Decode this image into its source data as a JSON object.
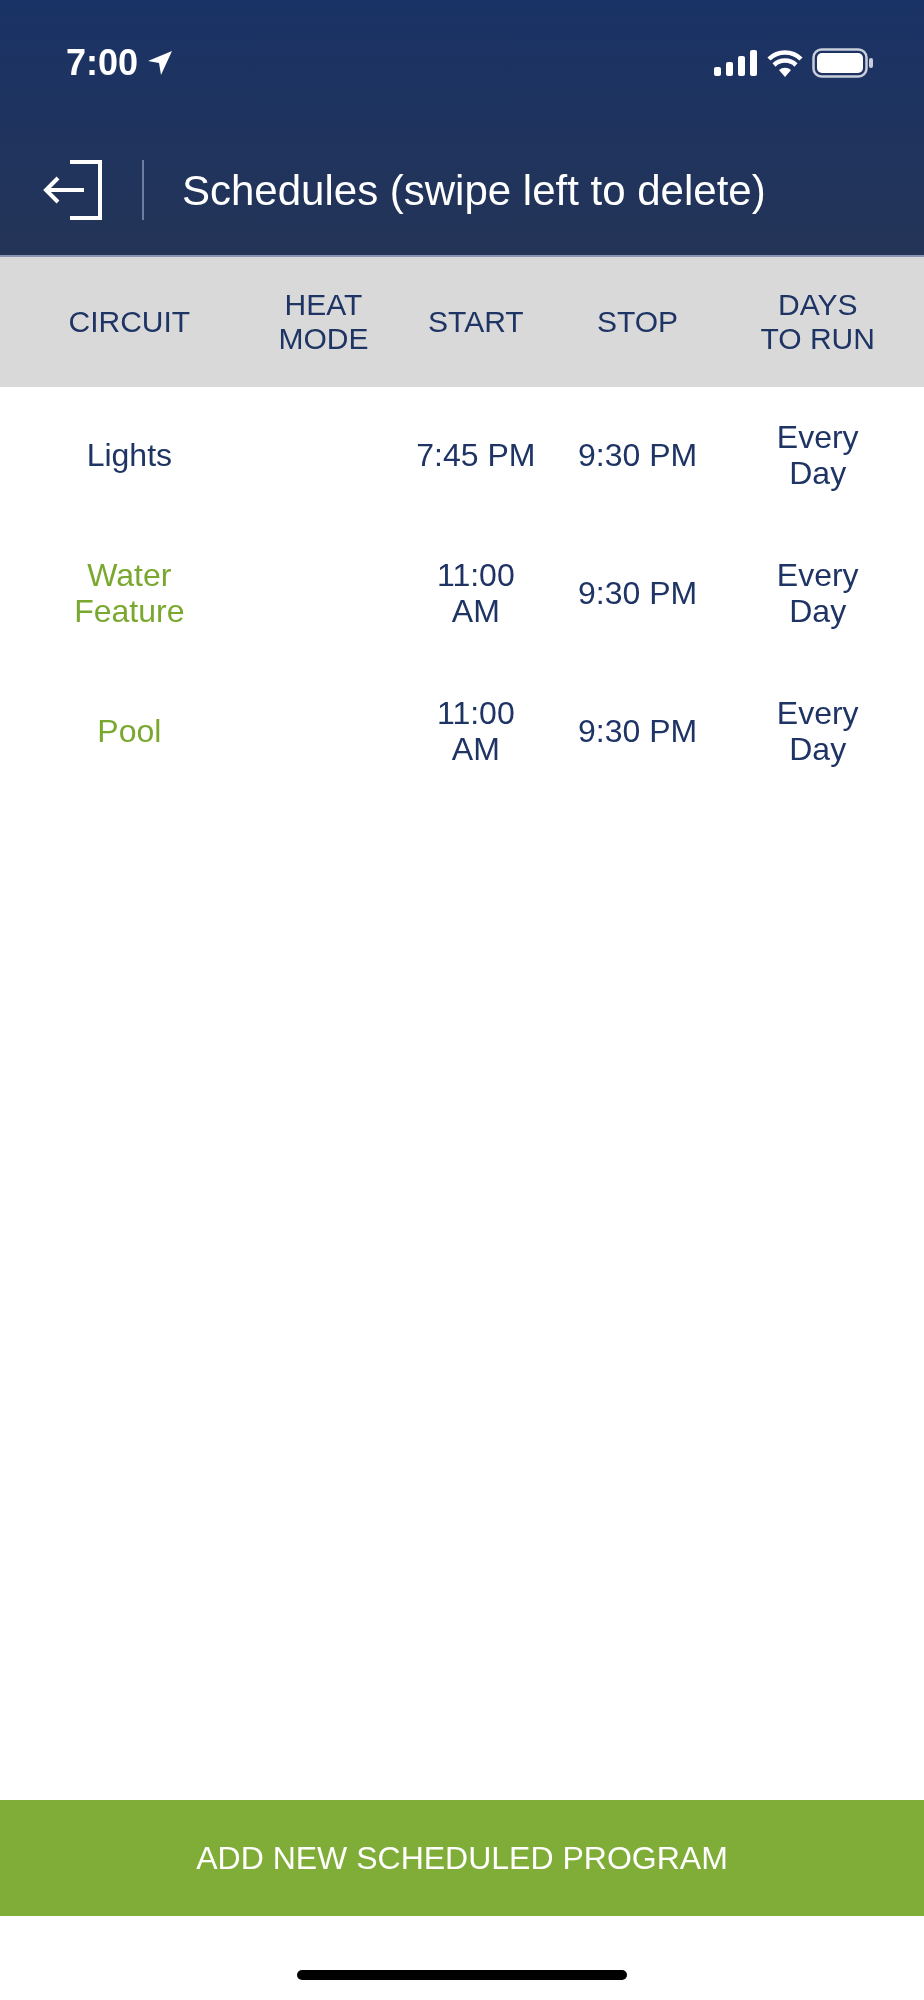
{
  "status_bar": {
    "time": "7:00"
  },
  "header": {
    "title": "Schedules (swipe left to delete)"
  },
  "table": {
    "columns": [
      {
        "lines": [
          "CIRCUIT"
        ]
      },
      {
        "lines": [
          "HEAT",
          "MODE"
        ]
      },
      {
        "lines": [
          "START"
        ]
      },
      {
        "lines": [
          "STOP"
        ]
      },
      {
        "lines": [
          "DAYS",
          "TO RUN"
        ]
      }
    ],
    "rows": [
      {
        "circuit": [
          "Lights"
        ],
        "color": "#1e3464",
        "heat_mode": [],
        "start": [
          "7:45 PM"
        ],
        "stop": [
          "9:30 PM"
        ],
        "days": [
          "Every",
          "Day"
        ]
      },
      {
        "circuit": [
          "Water",
          "Feature"
        ],
        "color": "#7aa82f",
        "heat_mode": [],
        "start": [
          "11:00",
          "AM"
        ],
        "stop": [
          "9:30 PM"
        ],
        "days": [
          "Every",
          "Day"
        ]
      },
      {
        "circuit": [
          "Pool"
        ],
        "color": "#7aa82f",
        "heat_mode": [],
        "start": [
          "11:00",
          "AM"
        ],
        "stop": [
          "9:30 PM"
        ],
        "days": [
          "Every",
          "Day"
        ]
      }
    ]
  },
  "add_button": {
    "label": "ADD NEW SCHEDULED PROGRAM"
  }
}
